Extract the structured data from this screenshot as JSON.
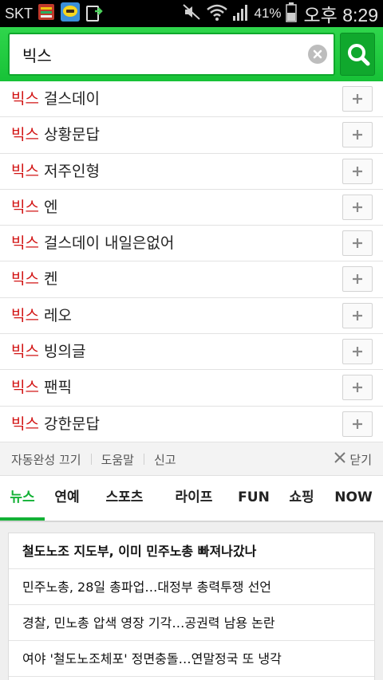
{
  "status_bar": {
    "carrier": "SKT",
    "battery_percent": "41%",
    "time": "오후 8:29",
    "icons": [
      "notification-app-icon",
      "kakaotalk-icon",
      "upload-icon",
      "mute-icon",
      "wifi-icon",
      "signal-icon",
      "battery-icon"
    ]
  },
  "search": {
    "query": "빅스",
    "icons": {
      "clear": "clear-icon",
      "submit": "search-icon"
    },
    "accent_color": "#19c23a"
  },
  "suggestions": [
    {
      "keyword": "빅스",
      "rest": " 걸스데이"
    },
    {
      "keyword": "빅스",
      "rest": " 상황문답"
    },
    {
      "keyword": "빅스",
      "rest": " 저주인형"
    },
    {
      "keyword": "빅스",
      "rest": " 엔"
    },
    {
      "keyword": "빅스",
      "rest": " 걸스데이 내일은없어"
    },
    {
      "keyword": "빅스",
      "rest": " 켄"
    },
    {
      "keyword": "빅스",
      "rest": " 레오"
    },
    {
      "keyword": "빅스",
      "rest": " 빙의글"
    },
    {
      "keyword": "빅스",
      "rest": " 팬픽"
    },
    {
      "keyword": "빅스",
      "rest": " 강한문답"
    }
  ],
  "suggest_footer": {
    "autocomplete_off": "자동완성 끄기",
    "help": "도움말",
    "report": "신고",
    "close": "닫기"
  },
  "tabs": [
    {
      "label": "뉴스",
      "active": true
    },
    {
      "label": "연예",
      "active": false
    },
    {
      "label": "스포츠",
      "active": false
    },
    {
      "label": "라이프",
      "active": false
    },
    {
      "label": "FUN",
      "active": false
    },
    {
      "label": "쇼핑",
      "active": false
    },
    {
      "label": "NOW",
      "active": false
    }
  ],
  "news": [
    "철도노조 지도부, 이미 민주노총 빠져나갔나",
    "민주노총, 28일 총파업…대정부 총력투쟁 선언",
    "경찰, 민노총 압색 영장 기각…공권력 남용 논란",
    "여야 '철도노조체포' 정면충돌…연말정국 또 냉각"
  ]
}
